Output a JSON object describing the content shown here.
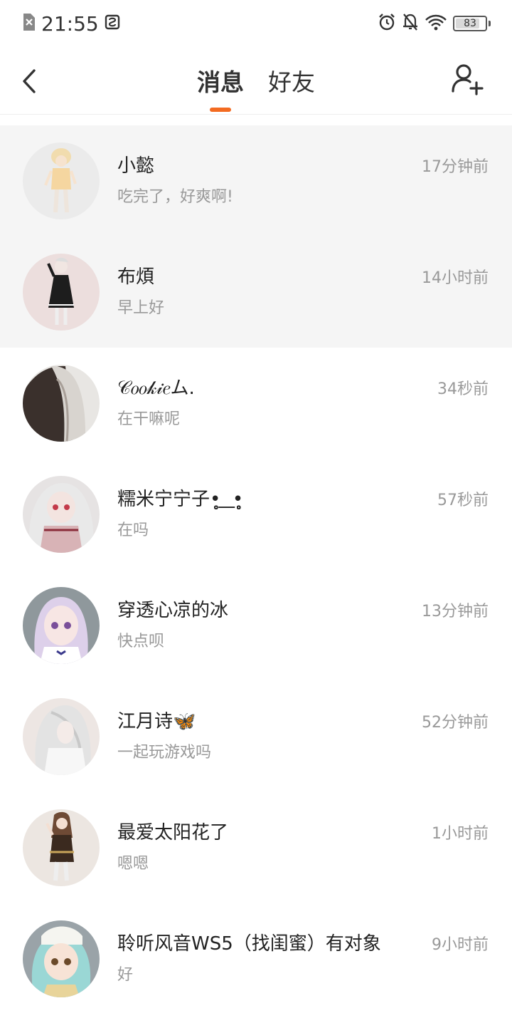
{
  "status_bar": {
    "time": "21:55",
    "battery": "83",
    "battery_level": 0.83,
    "icons": [
      "sim-off-icon",
      "screenshot-icon",
      "alarm-icon",
      "bell-off-icon",
      "wifi-icon",
      "battery-icon"
    ]
  },
  "header": {
    "tabs": [
      {
        "label": "消息",
        "active": true
      },
      {
        "label": "好友",
        "active": false
      }
    ],
    "accent_color": "#f36b21"
  },
  "conversations": [
    {
      "name": "小懿",
      "message": "吃完了，好爽啊!",
      "time": "17分钟前",
      "pinned": true
    },
    {
      "name": "布煩",
      "message": "早上好",
      "time": "14小时前",
      "pinned": true
    },
    {
      "name": "𝒞𝑜𝑜𝓀𝒾𝑒ム.",
      "message": "在干嘛呢",
      "time": "34秒前",
      "pinned": false
    },
    {
      "name": "糯米宁宁子•̥̥̥̥̥̥̥̥ ͟ •̥̥̥̥̥̥",
      "message": "在吗",
      "time": "57秒前",
      "pinned": false
    },
    {
      "name": "穿透心凉的冰",
      "message": "快点呗",
      "time": "13分钟前",
      "pinned": false
    },
    {
      "name": "江月诗🦋",
      "message": "一起玩游戏吗",
      "time": "52分钟前",
      "pinned": false
    },
    {
      "name": "最爱太阳花了",
      "message": "嗯嗯",
      "time": "1小时前",
      "pinned": false
    },
    {
      "name": "聆听风音WS5（找闺蜜）有对象",
      "message": "好",
      "time": "9小时前",
      "pinned": false
    }
  ]
}
